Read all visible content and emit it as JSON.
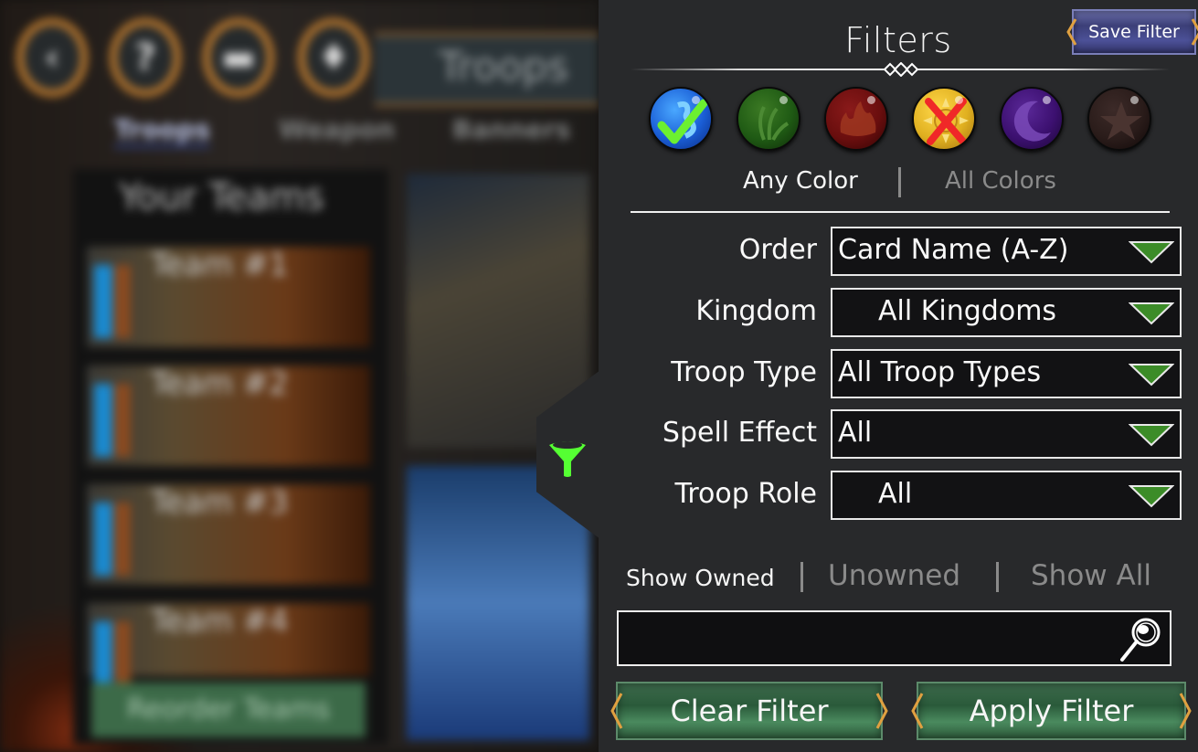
{
  "background": {
    "top_icons": [
      "back-icon",
      "help-icon",
      "chat-icon",
      "gem-icon"
    ],
    "top_icon_glyphs": [
      "‹",
      "?",
      "▬",
      "♦"
    ],
    "title": "Troops",
    "tabs": [
      "Troops",
      "Weapon",
      "Banners"
    ],
    "teams_title": "Your Teams",
    "teams": [
      "Team #1",
      "Team #2",
      "Team #3",
      "Team #4"
    ],
    "reorder_button": "Reorder Teams"
  },
  "panel": {
    "title": "Filters",
    "save_filter_label": "Save Filter",
    "colors": [
      {
        "name": "blue",
        "base": "#1a5ed6",
        "state": "required"
      },
      {
        "name": "green",
        "base": "#1f5a14",
        "state": "neutral"
      },
      {
        "name": "red",
        "base": "#6a0e0e",
        "state": "neutral"
      },
      {
        "name": "yellow",
        "base": "#e0b020",
        "state": "excluded"
      },
      {
        "name": "purple",
        "base": "#3c1070",
        "state": "neutral"
      },
      {
        "name": "brown",
        "base": "#2a1c1a",
        "state": "neutral"
      }
    ],
    "color_mode": {
      "options": [
        "Any Color",
        "All Colors"
      ],
      "selected": "Any Color"
    },
    "filters": [
      {
        "label": "Order",
        "value": "Card Name (A-Z)"
      },
      {
        "label": "Kingdom",
        "value": "All Kingdoms"
      },
      {
        "label": "Troop Type",
        "value": "All Troop Types"
      },
      {
        "label": "Spell Effect",
        "value": "All"
      },
      {
        "label": "Troop Role",
        "value": "All"
      }
    ],
    "ownership": {
      "options": [
        "Show Owned",
        "Unowned",
        "Show All"
      ],
      "selected": "Show Owned"
    },
    "search": {
      "value": "",
      "placeholder": ""
    },
    "clear_filter_label": "Clear Filter",
    "apply_filter_label": "Apply Filter",
    "accent_green": "#55ff33",
    "caret_green": "#3c8c28",
    "active_text": "#f5f5f5",
    "inactive_text": "#8a8a8a"
  }
}
